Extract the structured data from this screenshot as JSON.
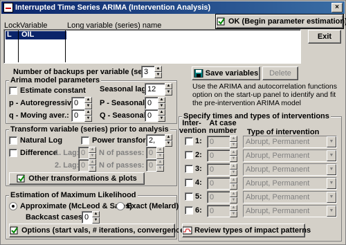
{
  "window": {
    "title": "Interrupted Time Series ARIMA (Intervention Analysis)"
  },
  "buttons": {
    "ok": "OK (Begin parameter estimation)",
    "exit": "Exit",
    "save": "Save variables",
    "delete": "Delete",
    "other_transforms": "Other transformations & plots",
    "options": "Options (start vals, # iterations, convergence)",
    "review": "Review types of impact patterns"
  },
  "var_table": {
    "headers": {
      "lock": "Lock",
      "variable": "Variable",
      "long_name": "Long variable (series) name"
    },
    "rows": [
      {
        "lock": "L",
        "variable": "OIL",
        "long_name": ""
      }
    ]
  },
  "backups": {
    "label": "Number of backups per variable (series):",
    "value": "3"
  },
  "info_text": "Use the ARIMA and autocorrelation functions option on the start-up panel to identify and fit the pre-intervention ARIMA model",
  "arima": {
    "title": "Arima model parameters",
    "estimate_constant": "Estimate constant",
    "seasonal_lag_label": "Seasonal lag:",
    "seasonal_lag": "12",
    "p_label": "p - Autoregressive:",
    "p": "0",
    "P_label": "P - Seasonal:",
    "P": "0",
    "q_label": "q - Moving aver.:",
    "q": "0",
    "Q_label": "Q - Seasonal:",
    "Q": "0"
  },
  "transform": {
    "title": "Transform variable (series) prior to analysis",
    "natural_log": "Natural Log",
    "power": "Power transform:",
    "power_value": "2,",
    "difference": "Difference",
    "lag1_label": "1. Lag:",
    "lag1": "0",
    "npass1_label": "N of passes:",
    "npass1": "0",
    "lag2_label": "2. Lag:",
    "lag2": "0",
    "npass2_label": "N of passes:",
    "npass2": "0"
  },
  "ml": {
    "title": "Estimation of Maximum Likelihood",
    "approx": "Approximate (McLeod & Sales)",
    "exact": "Exact (Melard)",
    "backcast_label": "Backcast cases:",
    "backcast": "0"
  },
  "interventions": {
    "title": "Specify times and types of interventions",
    "col_intervention": "Inter-vention",
    "col_case": "At case number",
    "col_type": "Type of intervention",
    "rows": [
      {
        "label": "1:",
        "case": "0",
        "type": "Abrupt, Permanent"
      },
      {
        "label": "2:",
        "case": "0",
        "type": "Abrupt, Permanent"
      },
      {
        "label": "3:",
        "case": "0",
        "type": "Abrupt, Permanent"
      },
      {
        "label": "4:",
        "case": "0",
        "type": "Abrupt, Permanent"
      },
      {
        "label": "5:",
        "case": "0",
        "type": "Abrupt, Permanent"
      },
      {
        "label": "6:",
        "case": "0",
        "type": "Abrupt, Permanent"
      }
    ]
  }
}
